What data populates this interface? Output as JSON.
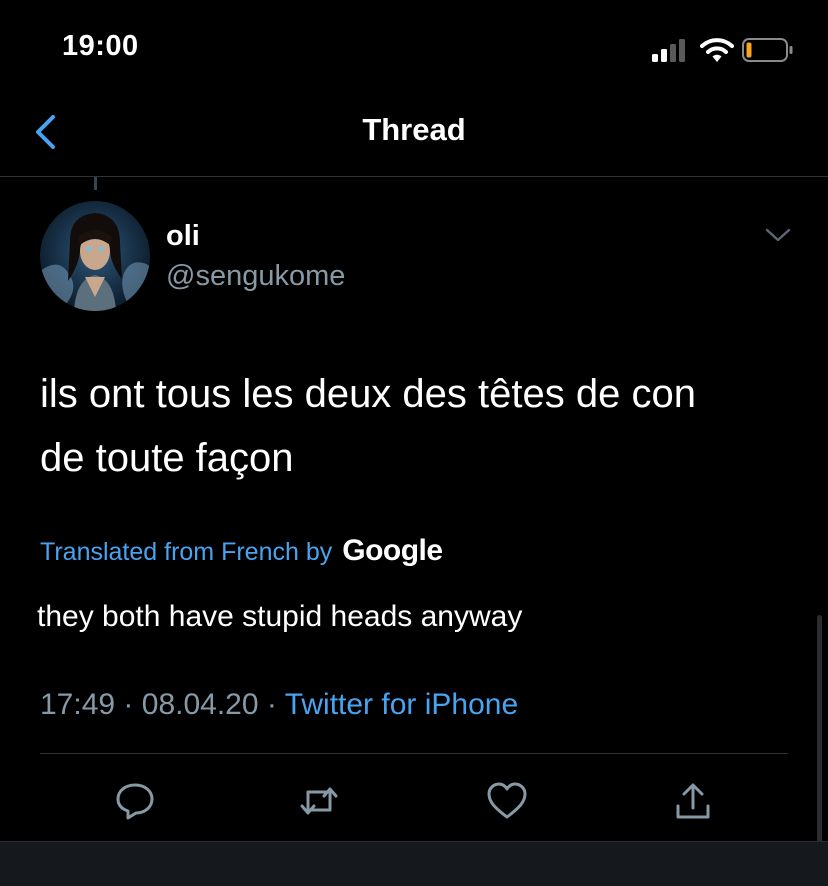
{
  "status_bar": {
    "time": "19:00"
  },
  "nav": {
    "title": "Thread"
  },
  "tweet": {
    "display_name": "oli",
    "handle": "@sengukome",
    "text_line_1": "ils ont tous les deux des têtes de con",
    "text_line_2": "de toute façon",
    "translated_label": "Translated from French by",
    "translation_provider": "Google",
    "translation": "they both have stupid heads anyway",
    "time": "17:49",
    "separator": "·",
    "date": "08.04.20",
    "source": "Twitter for iPhone"
  },
  "icons": {
    "back": "chevron-left-icon",
    "menu": "chevron-down-icon",
    "reply": "reply-icon",
    "retweet": "retweet-icon",
    "like": "heart-icon",
    "share": "share-icon"
  },
  "colors": {
    "background": "#000000",
    "accent": "#4aa3f0",
    "secondary_text": "#8899a6",
    "battery_level": "#f5a623"
  }
}
